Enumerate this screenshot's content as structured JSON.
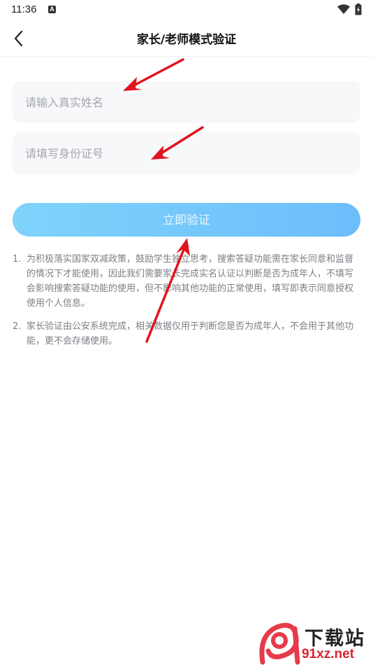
{
  "status_bar": {
    "time": "11:36",
    "notification_icon_letter": "A"
  },
  "header": {
    "title": "家长/老师模式验证"
  },
  "form": {
    "name_placeholder": "请输入真实姓名",
    "id_placeholder": "请填写身份证号",
    "submit_label": "立即验证"
  },
  "notes": [
    {
      "number": "1.",
      "text": "为积极落实国家双减政策，鼓励学生独立思考，搜索答疑功能需在家长同意和监督的情况下才能使用，因此我们需要家长完成实名认证以判断是否为成年人，不填写会影响搜索答疑功能的使用，但不影响其他功能的正常使用，填写即表示同意授权使用个人信息。"
    },
    {
      "number": "2.",
      "text": "家长验证由公安系统完成，相关数据仅用于判断您是否为成年人，不会用于其他功能，更不会存储使用。"
    }
  ],
  "watermark": {
    "title": "下载站",
    "url": "91xz.net"
  },
  "colors": {
    "button_gradient_start": "#7fd3fb",
    "button_gradient_end": "#6cbdfb",
    "field_bg": "#f7f8fa",
    "note_text": "#7c7f85",
    "arrow": "#e0141e"
  }
}
